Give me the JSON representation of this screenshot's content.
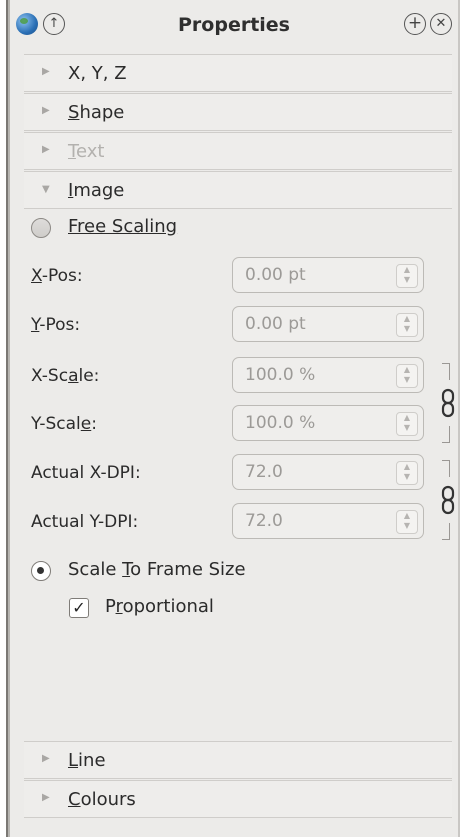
{
  "titlebar": {
    "title": "Properties"
  },
  "sections": {
    "xyz": "X, Y, Z",
    "shape_u": "S",
    "shape_rest": "hape",
    "text_u": "T",
    "text_rest": "ext",
    "image_u": "I",
    "image_rest": "mage",
    "line_u": "L",
    "line_rest": "ine",
    "colours_u": "C",
    "colours_rest": "olours"
  },
  "image": {
    "free_scaling": "Free Scaling",
    "free_scaling_selected": false,
    "fields": [
      {
        "label_pre": "",
        "label_u": "X",
        "label_post": "-Pos:",
        "value": "0.00 pt"
      },
      {
        "label_pre": "",
        "label_u": "Y",
        "label_post": "-Pos:",
        "value": "0.00 pt"
      },
      {
        "label_pre": "X-Sc",
        "label_u": "a",
        "label_post": "le:",
        "value": "100.0 %"
      },
      {
        "label_pre": "Y-Scal",
        "label_u": "e",
        "label_post": ":",
        "value": "100.0 %"
      },
      {
        "label_pre": "Actual X-DPI:",
        "label_u": "",
        "label_post": "",
        "value": "72.0"
      },
      {
        "label_pre": "Actual Y-DPI:",
        "label_u": "",
        "label_post": "",
        "value": "72.0"
      }
    ],
    "scale_to_frame": {
      "pre": "Scale ",
      "u": "T",
      "post": "o Frame Size",
      "selected": true
    },
    "proportional": {
      "pre": "P",
      "u": "r",
      "post": "oportional",
      "checked": true,
      "mark": "✓"
    }
  },
  "colors": {
    "panel_bg": "#ecebe9",
    "disabled_text": "#b3b1ae",
    "field_text": "#9c9a97"
  },
  "icons": {
    "globe": "globe-icon",
    "up": "up-arrow-icon",
    "plus": "plus-icon",
    "close": "close-icon",
    "chain": "chain-link-icon"
  }
}
